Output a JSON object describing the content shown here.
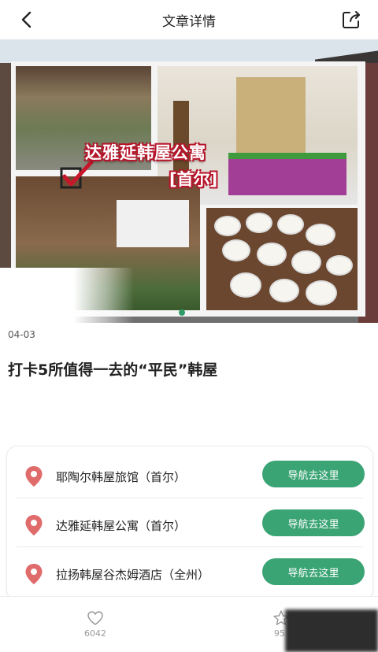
{
  "header": {
    "title": "文章详情",
    "back_icon": "chevron-left-icon",
    "share_icon": "share-icon"
  },
  "hero": {
    "overlay_title": "达雅延韩屋公寓",
    "overlay_subtitle": "[首尔]"
  },
  "article": {
    "date": "04-03",
    "title": "打卡5所值得一去的“平民”韩屋"
  },
  "locations": [
    {
      "name": "耶陶尔韩屋旅馆（首尔）",
      "button": "导航去这里"
    },
    {
      "name": "达雅延韩屋公寓（首尔）",
      "button": "导航去这里"
    },
    {
      "name": "拉扬韩屋谷杰姆酒店（全州）",
      "button": "导航去这里"
    }
  ],
  "bottom_bar": {
    "like_count": "6042",
    "favorite_count": "95"
  },
  "colors": {
    "accent": "#3aa474",
    "pin": "#e06b6b"
  }
}
